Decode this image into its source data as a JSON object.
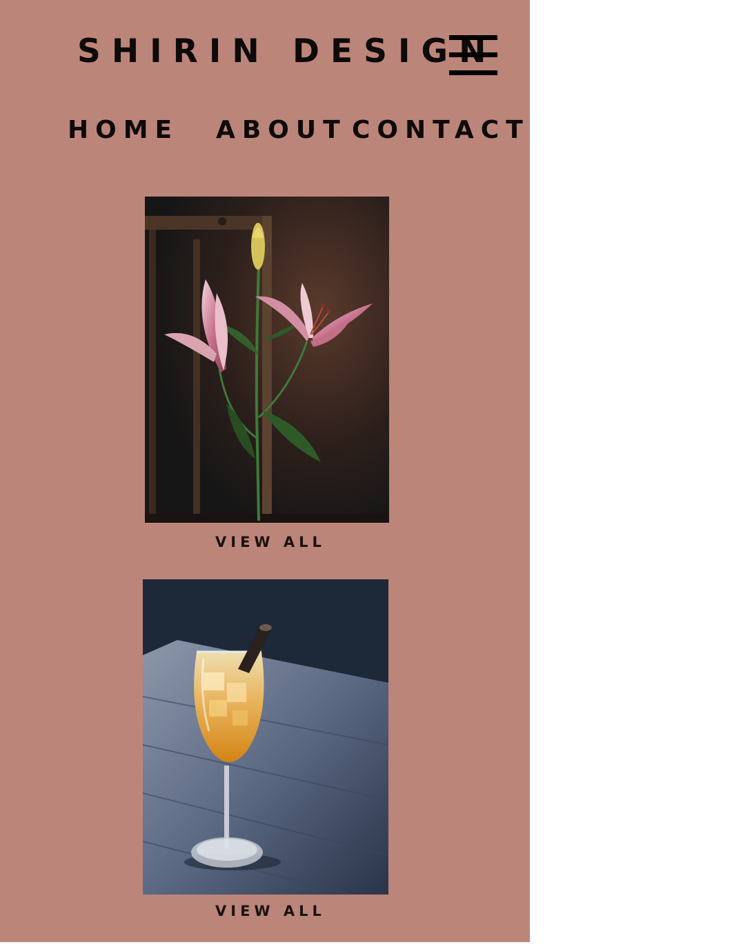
{
  "header": {
    "brand": "SHIRIN DESIGN",
    "menu_icon": "hamburger-menu-icon"
  },
  "nav": {
    "items": [
      {
        "label": "HOME"
      },
      {
        "label": "ABOUT"
      },
      {
        "label": "CONTACT"
      }
    ]
  },
  "gallery": {
    "items": [
      {
        "image": "lily-flower-photo",
        "link_label": "VIEW ALL"
      },
      {
        "image": "cocktail-glass-photo",
        "link_label": "VIEW ALL"
      }
    ]
  },
  "colors": {
    "background": "#bc857a",
    "text": "#0d0a09",
    "page_outside": "#ffffff"
  }
}
